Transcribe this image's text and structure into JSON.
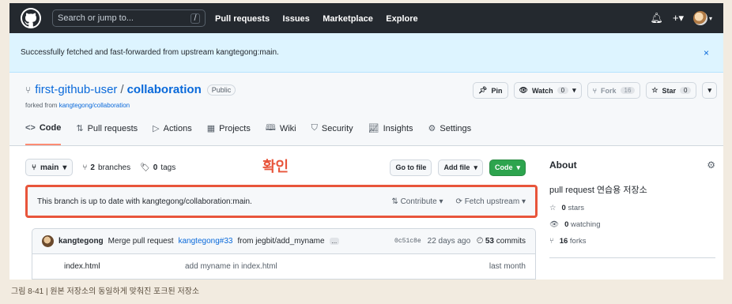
{
  "header": {
    "search_placeholder": "Search or jump to...",
    "search_shortcut": "/",
    "nav": [
      "Pull requests",
      "Issues",
      "Marketplace",
      "Explore"
    ]
  },
  "flash": {
    "message": "Successfully fetched and fast-forwarded from upstream kangtegong:main.",
    "close": "×"
  },
  "repo": {
    "owner": "first-github-user",
    "sep": "/",
    "name": "collaboration",
    "visibility": "Public",
    "forked_prefix": "forked from",
    "forked_link": "kangtegong/collaboration",
    "pin": "Pin",
    "watch": "Watch",
    "watch_count": "0",
    "fork": "Fork",
    "fork_count": "16",
    "star": "Star",
    "star_count": "0"
  },
  "tabs": [
    {
      "label": "Code",
      "icon": "code-icon"
    },
    {
      "label": "Pull requests",
      "icon": "pr-icon"
    },
    {
      "label": "Actions",
      "icon": "play-icon"
    },
    {
      "label": "Projects",
      "icon": "table-icon"
    },
    {
      "label": "Wiki",
      "icon": "book-icon"
    },
    {
      "label": "Security",
      "icon": "shield-icon"
    },
    {
      "label": "Insights",
      "icon": "graph-icon"
    },
    {
      "label": "Settings",
      "icon": "gear-icon"
    }
  ],
  "main": {
    "branch": "main",
    "branches_count": "2",
    "branches_label": "branches",
    "tags_count": "0",
    "tags_label": "tags",
    "annotation": "확인",
    "go_to_file": "Go to file",
    "add_file": "Add file",
    "code_btn": "Code",
    "uptodate_text": "This branch is up to date with kangtegong/collaboration:main.",
    "contribute": "Contribute",
    "fetch_upstream": "Fetch upstream",
    "commit_author": "kangtegong",
    "commit_msg_prefix": "Merge pull request",
    "commit_link": "kangtegong#33",
    "commit_msg_suffix": "from jegbit/add_myname",
    "commit_ellipsis": "...",
    "commit_sha": "0c51c8e",
    "commit_time": "22 days ago",
    "commits_count": "53",
    "commits_label": "commits",
    "file_name": "index.html",
    "file_msg": "add myname in index.html",
    "file_time": "last month"
  },
  "about": {
    "title": "About",
    "description": "pull request 연습용 저장소",
    "stars_count": "0",
    "stars_label": "stars",
    "watching_count": "0",
    "watching_label": "watching",
    "forks_count": "16",
    "forks_label": "forks"
  },
  "caption": "그림 8-41 | 원본 저장소의 동일하게 맞춰진 포크된 저장소",
  "colors": {
    "accent": "#0969da",
    "highlight": "#e8553b",
    "code_btn": "#2da44e"
  }
}
